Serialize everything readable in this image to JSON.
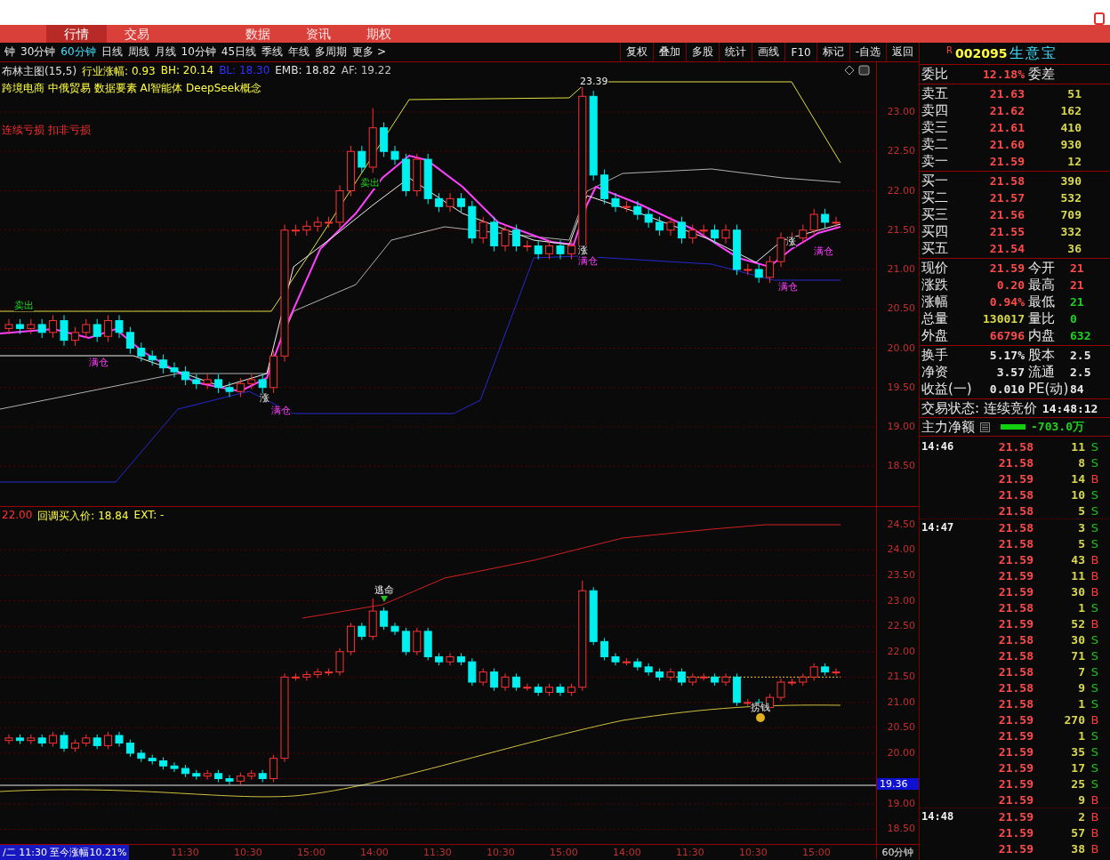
{
  "top_menu": [
    {
      "label": "行情",
      "selected": true
    },
    {
      "label": "交易",
      "selected": false
    },
    {
      "label": "数据",
      "selected": false
    },
    {
      "label": "资讯",
      "selected": false
    },
    {
      "label": "期权",
      "selected": false
    }
  ],
  "periods": [
    {
      "label": "钟",
      "selected": false
    },
    {
      "label": "30分钟",
      "selected": false
    },
    {
      "label": "60分钟",
      "selected": true
    },
    {
      "label": "日线",
      "selected": false
    },
    {
      "label": "周线",
      "selected": false
    },
    {
      "label": "月线",
      "selected": false
    },
    {
      "label": "10分钟",
      "selected": false
    },
    {
      "label": "45日线",
      "selected": false
    },
    {
      "label": "季线",
      "selected": false
    },
    {
      "label": "年线",
      "selected": false
    },
    {
      "label": "多周期",
      "selected": false
    },
    {
      "label": "更多 >",
      "selected": false
    }
  ],
  "toolbar": [
    "复权",
    "叠加",
    "多股",
    "统计",
    "画线",
    "F10",
    "标记",
    "-自选",
    "返回"
  ],
  "upper_chart": {
    "indicators": [
      {
        "text": "布林主图(15,5)",
        "color": "#e0e0e0"
      },
      {
        "text": "行业涨幅: 0.93",
        "color": "#ffff40"
      },
      {
        "text": "BH: 20.14",
        "color": "#ffff40"
      },
      {
        "text": "BL: 18.30",
        "color": "#3030ff"
      },
      {
        "text": "EMB: 18.82",
        "color": "#e0e0e0"
      },
      {
        "text": "AF: 19.22",
        "color": "#c0c0c0"
      }
    ],
    "concepts": "跨境电商 中俄贸易 数据要素 AI智能体 DeepSeek概念",
    "warnings": "连续亏损 扣非亏损",
    "markers": [
      {
        "text": "23.39",
        "kind": "price"
      },
      {
        "text": "卖出",
        "kind": "sell"
      },
      {
        "text": "卖出",
        "kind": "sell"
      },
      {
        "text": "满仓",
        "kind": "position"
      },
      {
        "text": "满仓",
        "kind": "position"
      },
      {
        "text": "满仓",
        "kind": "position"
      },
      {
        "text": "满仓",
        "kind": "position"
      },
      {
        "text": "满仓",
        "kind": "position"
      },
      {
        "text": "涨",
        "kind": "signal"
      },
      {
        "text": "涨",
        "kind": "signal"
      },
      {
        "text": "涨",
        "kind": "signal"
      }
    ],
    "yticks": [
      "23.00",
      "22.50",
      "22.00",
      "21.50",
      "21.00",
      "20.50",
      "20.00",
      "19.50",
      "19.00",
      "18.50"
    ]
  },
  "lower_chart": {
    "header": [
      {
        "text": "22.00",
        "color": "#ff3030"
      },
      {
        "text": "回调买入价: 18.84",
        "color": "#ffff40"
      },
      {
        "text": "EXT: -",
        "color": "#ffff40"
      }
    ],
    "markers": [
      {
        "text": "逃命",
        "kind": "escape"
      },
      {
        "text": "捞钱",
        "kind": "money"
      }
    ],
    "yticks": [
      "24.50",
      "24.00",
      "23.50",
      "23.00",
      "22.50",
      "22.00",
      "21.50",
      "21.00",
      "20.50",
      "20.00",
      "19.00",
      "18.50"
    ],
    "price_tag": "19.36"
  },
  "time_axis": {
    "status": "/二 11:30 至今涨幅10.21%",
    "labels": [
      "11:30",
      "10:30",
      "15:00",
      "14:00",
      "11:30",
      "10:30",
      "15:00",
      "14:00",
      "11:30",
      "10:30",
      "15:00"
    ],
    "period": "60分钟"
  },
  "stock": {
    "flag": "R",
    "code": "002095",
    "name": "生意宝"
  },
  "order_ratio": {
    "label": "委比",
    "value": "12.18%",
    "label2": "委差"
  },
  "asks": [
    {
      "label": "卖五",
      "price": "21.63",
      "volume": "51"
    },
    {
      "label": "卖四",
      "price": "21.62",
      "volume": "162"
    },
    {
      "label": "卖三",
      "price": "21.61",
      "volume": "410"
    },
    {
      "label": "卖二",
      "price": "21.60",
      "volume": "930"
    },
    {
      "label": "卖一",
      "price": "21.59",
      "volume": "12"
    }
  ],
  "bids": [
    {
      "label": "买一",
      "price": "21.58",
      "volume": "390"
    },
    {
      "label": "买二",
      "price": "21.57",
      "volume": "532"
    },
    {
      "label": "买三",
      "price": "21.56",
      "volume": "709"
    },
    {
      "label": "买四",
      "price": "21.55",
      "volume": "332"
    },
    {
      "label": "买五",
      "price": "21.54",
      "volume": "36"
    }
  ],
  "quote": [
    {
      "cells": [
        {
          "label": "现价",
          "value": "21.59",
          "color": "#ff4a4a"
        },
        {
          "label": "今开",
          "value": "21",
          "color": "#ff4a4a"
        }
      ]
    },
    {
      "cells": [
        {
          "label": "涨跌",
          "value": "0.20",
          "color": "#ff4a4a"
        },
        {
          "label": "最高",
          "value": "21",
          "color": "#ff4a4a"
        }
      ]
    },
    {
      "cells": [
        {
          "label": "涨幅",
          "value": "0.94%",
          "color": "#ff4a4a"
        },
        {
          "label": "最低",
          "value": "21",
          "color": "#20d020"
        }
      ]
    },
    {
      "cells": [
        {
          "label": "总量",
          "value": "130017",
          "color": "#d8d84a"
        },
        {
          "label": "量比",
          "value": "0",
          "color": "#20d020"
        }
      ]
    },
    {
      "cells": [
        {
          "label": "外盘",
          "value": "66796",
          "color": "#ff4a4a"
        },
        {
          "label": "内盘",
          "value": "632",
          "color": "#20d020"
        }
      ]
    }
  ],
  "fundamentals": [
    {
      "cells": [
        {
          "label": "换手",
          "value": "5.17%",
          "color": "#e8e8e8"
        },
        {
          "label": "股本",
          "value": "2.5",
          "color": "#e8e8e8"
        }
      ]
    },
    {
      "cells": [
        {
          "label": "净资",
          "value": "3.57",
          "color": "#e8e8e8"
        },
        {
          "label": "流通",
          "value": "2.5",
          "color": "#e8e8e8"
        }
      ]
    },
    {
      "cells": [
        {
          "label": "收益(一)",
          "value": "0.010",
          "color": "#e8e8e8"
        },
        {
          "label": "PE(动)",
          "value": "84",
          "color": "#e8e8e8"
        }
      ]
    }
  ],
  "trade_status": {
    "label": "交易状态: 连续竞价",
    "time": "14:48:12"
  },
  "main_flow": {
    "label": "主力净额",
    "value": "-703.0万"
  },
  "ticks": [
    {
      "time": "14:46",
      "price": "21.58",
      "volume": "11",
      "side": "S",
      "kind": "sell"
    },
    {
      "price": "21.58",
      "volume": "8",
      "side": "S",
      "kind": "sell"
    },
    {
      "price": "21.59",
      "volume": "14",
      "side": "B",
      "kind": "buy"
    },
    {
      "price": "21.58",
      "volume": "10",
      "side": "S",
      "kind": "sell"
    },
    {
      "price": "21.58",
      "volume": "5",
      "side": "S",
      "kind": "sell"
    },
    {
      "time": "14:47",
      "price": "21.58",
      "volume": "3",
      "side": "S",
      "kind": "sell"
    },
    {
      "price": "21.58",
      "volume": "5",
      "side": "S",
      "kind": "sell"
    },
    {
      "price": "21.59",
      "volume": "43",
      "side": "B",
      "kind": "buy"
    },
    {
      "price": "21.59",
      "volume": "11",
      "side": "B",
      "kind": "buy"
    },
    {
      "price": "21.59",
      "volume": "30",
      "side": "B",
      "kind": "buy"
    },
    {
      "price": "21.58",
      "volume": "1",
      "side": "S",
      "kind": "sell"
    },
    {
      "price": "21.59",
      "volume": "52",
      "side": "B",
      "kind": "buy"
    },
    {
      "price": "21.58",
      "volume": "30",
      "side": "S",
      "kind": "sell"
    },
    {
      "price": "21.58",
      "volume": "71",
      "side": "S",
      "kind": "sell"
    },
    {
      "price": "21.58",
      "volume": "7",
      "side": "S",
      "kind": "sell"
    },
    {
      "price": "21.58",
      "volume": "9",
      "side": "S",
      "kind": "sell"
    },
    {
      "price": "21.58",
      "volume": "1",
      "side": "S",
      "kind": "sell"
    },
    {
      "price": "21.59",
      "volume": "270",
      "side": "B",
      "kind": "buy"
    },
    {
      "price": "21.59",
      "volume": "1",
      "side": "S",
      "kind": "sell"
    },
    {
      "price": "21.59",
      "volume": "35",
      "side": "S",
      "kind": "sell"
    },
    {
      "price": "21.59",
      "volume": "17",
      "side": "S",
      "kind": "sell"
    },
    {
      "price": "21.59",
      "volume": "25",
      "side": "S",
      "kind": "sell"
    },
    {
      "price": "21.59",
      "volume": "9",
      "side": "B",
      "kind": "buy"
    },
    {
      "time": "14:48",
      "price": "21.59",
      "volume": "2",
      "side": "B",
      "kind": "buy"
    },
    {
      "price": "21.59",
      "volume": "57",
      "side": "B",
      "kind": "buy"
    },
    {
      "price": "21.59",
      "volume": "38",
      "side": "B",
      "kind": "buy"
    }
  ]
}
